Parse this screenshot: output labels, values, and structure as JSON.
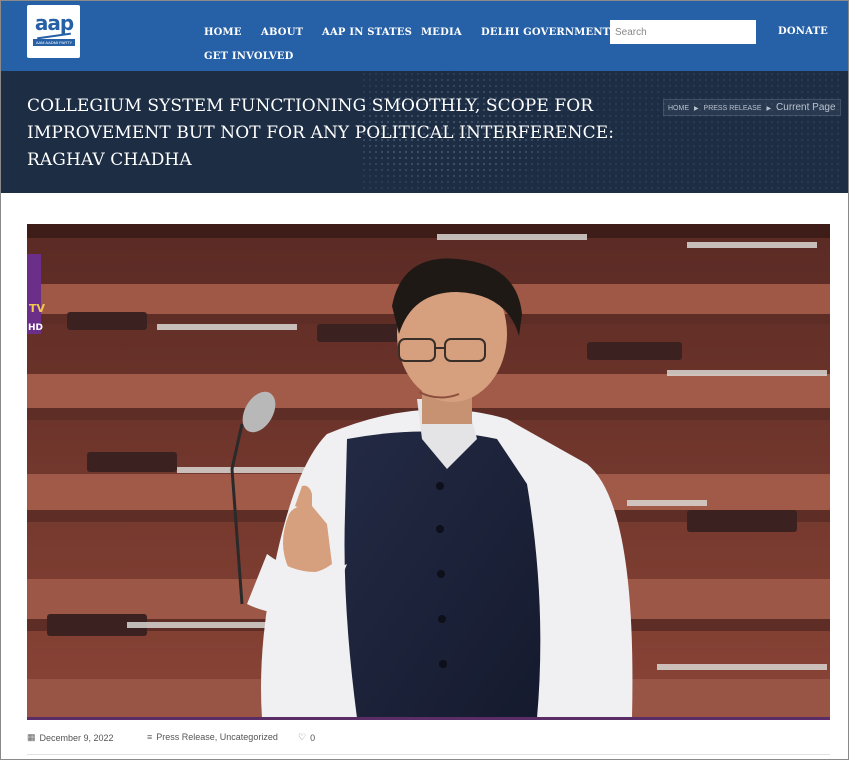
{
  "logo": {
    "text": "aap",
    "tagline": "AAM AADMI PARTY"
  },
  "nav": {
    "items": [
      "HOME",
      "ABOUT",
      "AAP IN STATES",
      "MEDIA",
      "DELHI GOVERNMENT",
      "GET INVOLVED"
    ],
    "donate": "DONATE"
  },
  "search": {
    "placeholder": "Search",
    "value": ""
  },
  "banner": {
    "title_lines": [
      "COLLEGIUM SYSTEM FUNCTIONING SMOOTHLY, SCOPE FOR",
      "IMPROVEMENT BUT NOT FOR ANY POLITICAL INTERFERENCE:",
      "RAGHAV CHADHA"
    ],
    "breadcrumb": [
      "HOME",
      "PRESS RELEASE",
      "Current Page"
    ]
  },
  "photo": {
    "overlay_text": [
      "TV",
      "HD"
    ]
  },
  "meta": {
    "date": "December 9, 2022",
    "categories": "Press Release, Uncategorized",
    "likes": "0"
  },
  "colors": {
    "header": "#2660a6",
    "banner": "#1c2d44",
    "accent_bar": "#5b2d66"
  }
}
